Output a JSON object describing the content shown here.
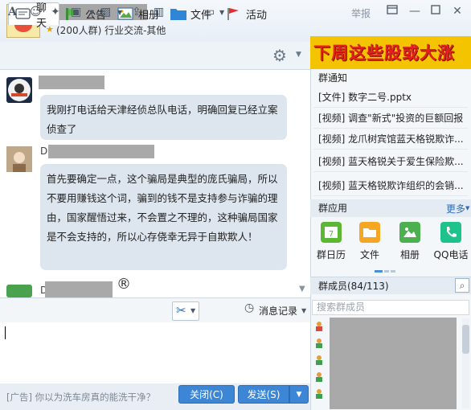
{
  "header": {
    "group_info": "(200人群) 行业交流-其他",
    "report": "举报"
  },
  "tabs": [
    {
      "label": "聊天",
      "icon": "chat-icon"
    },
    {
      "label": "公告",
      "icon": "announcement-icon"
    },
    {
      "label": "相册",
      "icon": "album-icon"
    },
    {
      "label": "文件",
      "icon": "folder-icon"
    },
    {
      "label": "活动",
      "icon": "flag-icon"
    }
  ],
  "banner": {
    "text": "下周这些股或大涨"
  },
  "messages": [
    {
      "text": "我刚打电话给天津经侦总队电话，明确回复已经立案侦查了"
    },
    {
      "name_prefix": "D",
      "text": "首先要确定一点，这个骗局是典型的庞氏骗局，所以不要用赚钱这个词，骗到的钱不是支持参与诈骗的理由，国家醒悟过来，不会置之不理的，这种骗局国家是不会支持的，所以心存侥幸无异于自欺欺人！"
    },
    {
      "name_prefix": "D"
    }
  ],
  "toolbar": {
    "history_label": "消息记录"
  },
  "bottom": {
    "ad": "[广告] 你以为洗车房真的能洗干净？",
    "close_label": "关闭(C)",
    "send_label": "发送(S)"
  },
  "notice": {
    "title": "群通知",
    "items": [
      "[文件] 数字二号.pptx",
      "[视频] 调查\"新式\"投资的巨额回报",
      "[视频] 龙爪树宾馆蓝天格锐欺诈...",
      "[视频] 蓝天格锐关于爱生保险欺...",
      "[视频] 蓝天格锐欺诈组织的会销..."
    ]
  },
  "apps": {
    "title": "群应用",
    "more": "更多",
    "items": [
      {
        "label": "群日历",
        "color": "#5cb832"
      },
      {
        "label": "文件",
        "color": "#f5a623"
      },
      {
        "label": "相册",
        "color": "#4caf50"
      },
      {
        "label": "QQ电话",
        "color": "#1ec28b"
      }
    ]
  },
  "members": {
    "title": "群成员(84/113)",
    "search_placeholder": "搜索群成员"
  },
  "colors": {
    "accent": "#3d86d5",
    "bubble": "#dde5ee",
    "banner_bg": "#f5c400",
    "banner_text": "#e62020"
  }
}
